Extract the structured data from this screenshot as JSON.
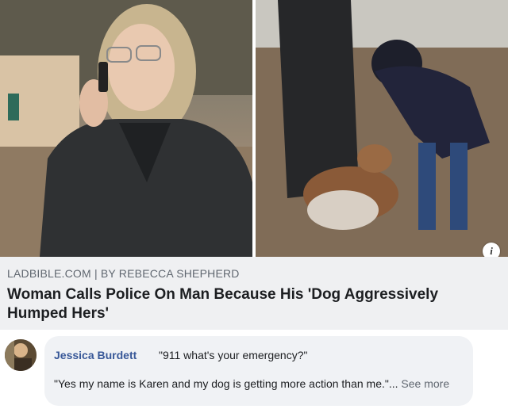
{
  "link_card": {
    "source": "LADBIBLE.COM | BY REBECCA SHEPHERD",
    "headline": "Woman Calls Police On Man Because His 'Dog Aggressively Humped Hers'"
  },
  "info_badge": "i",
  "comment": {
    "author": "Jessica Burdett",
    "text_line1": "\"911 what's your emergency?\"",
    "text_line2": "\"Yes my name is Karen and my dog is getting more action than me.\"...",
    "see_more": "See more"
  },
  "icons": {
    "info": "info-icon"
  }
}
